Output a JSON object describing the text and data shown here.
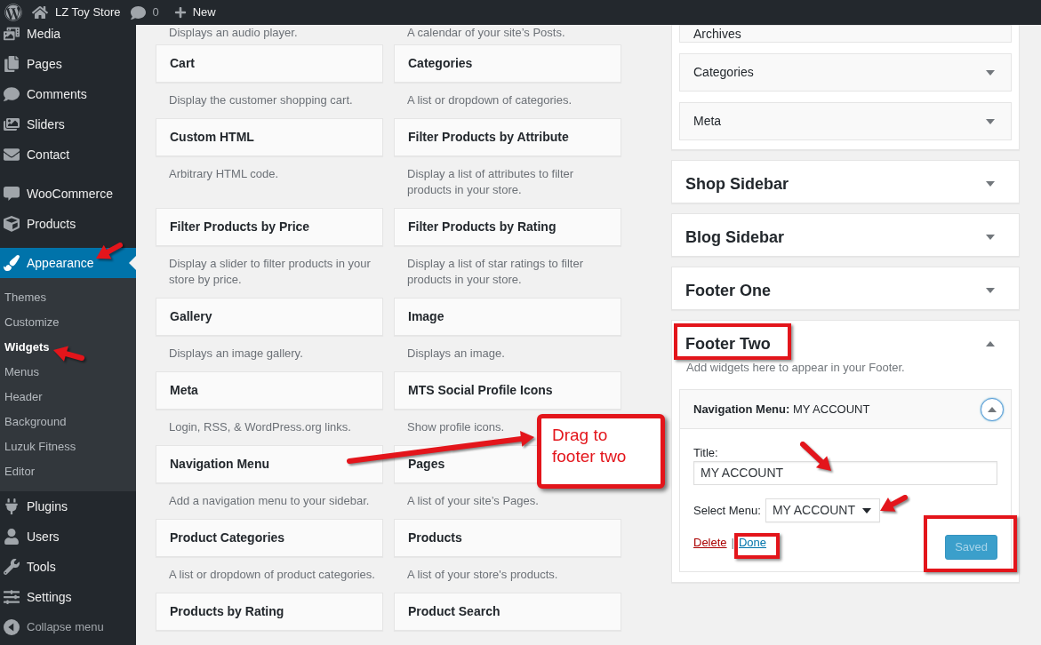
{
  "admin_bar": {
    "site_name": "LZ Toy Store",
    "comments_count": "0",
    "new_label": "New"
  },
  "sidebar": {
    "groups": [
      {
        "items": [
          {
            "label": "Media",
            "selected": false
          },
          {
            "label": "Pages",
            "selected": false
          },
          {
            "label": "Comments",
            "selected": false
          },
          {
            "label": "Sliders",
            "selected": false
          },
          {
            "label": "Contact",
            "selected": false
          }
        ]
      },
      {
        "items": [
          {
            "label": "WooCommerce",
            "selected": false
          },
          {
            "label": "Products",
            "selected": false
          }
        ]
      },
      {
        "items": [
          {
            "label": "Appearance",
            "selected": true,
            "expanded": true,
            "children": [
              {
                "label": "Themes",
                "selected": false
              },
              {
                "label": "Customize",
                "selected": false
              },
              {
                "label": "Widgets",
                "selected": true
              },
              {
                "label": "Menus",
                "selected": false
              },
              {
                "label": "Header",
                "selected": false
              },
              {
                "label": "Background",
                "selected": false
              },
              {
                "label": "Luzuk Fitness",
                "selected": false
              },
              {
                "label": "Editor",
                "selected": false
              }
            ]
          },
          {
            "label": "Plugins",
            "selected": false
          },
          {
            "label": "Users",
            "selected": false
          },
          {
            "label": "Tools",
            "selected": false
          },
          {
            "label": "Settings",
            "selected": false
          }
        ]
      }
    ],
    "collapse_label": "Collapse menu"
  },
  "available_widgets": [
    {
      "description": "Displays an audio player."
    },
    {
      "description": "A calendar of your site’s Posts."
    },
    {
      "title": "Cart",
      "description": "Display the customer shopping cart."
    },
    {
      "title": "Categories",
      "description": "A list or dropdown of categories."
    },
    {
      "title": "Custom HTML",
      "description": "Arbitrary HTML code."
    },
    {
      "title": "Filter Products by Attribute",
      "description": "Display a list of attributes to filter products in your store."
    },
    {
      "title": "Filter Products by Price",
      "description": "Display a slider to filter products in your store by price."
    },
    {
      "title": "Filter Products by Rating",
      "description": "Display a list of star ratings to filter products in your store."
    },
    {
      "title": "Gallery",
      "description": "Displays an image gallery."
    },
    {
      "title": "Image",
      "description": "Displays an image."
    },
    {
      "title": "Meta",
      "description": "Login, RSS, & WordPress.org links."
    },
    {
      "title": "MTS Social Profile Icons",
      "description": "Show profile icons."
    },
    {
      "title": "Navigation Menu",
      "description": "Add a navigation menu to your sidebar."
    },
    {
      "title": "Pages",
      "description": "A list of your site’s Pages."
    },
    {
      "title": "Product Categories",
      "description": "A list or dropdown of product categories."
    },
    {
      "title": "Products",
      "description": "A list of your store's products."
    },
    {
      "title": "Products by Rating"
    },
    {
      "title": "Product Search"
    }
  ],
  "widget_areas": [
    {
      "expanded": true,
      "highlighted": false,
      "widgets": [
        {
          "title": "Archives",
          "expanded": false
        },
        {
          "title": "Categories",
          "expanded": false
        },
        {
          "title": "Meta",
          "expanded": false
        }
      ]
    },
    {
      "title": "Shop Sidebar",
      "expanded": false,
      "highlighted": false
    },
    {
      "title": "Blog Sidebar",
      "expanded": false,
      "highlighted": false
    },
    {
      "title": "Footer One",
      "expanded": false,
      "highlighted": false
    },
    {
      "title": "Footer Two",
      "expanded": true,
      "highlighted": true,
      "description": "Add widgets here to appear in your Footer.",
      "widgets": [
        {
          "title": "**Navigation Menu:** MY ACCOUNT",
          "expanded": true,
          "form": {
            "fields": [
              {
                "kind": "text",
                "label": "Title:",
                "value": "MY ACCOUNT"
              },
              {
                "kind": "select",
                "label": "Select Menu:",
                "value": "MY ACCOUNT"
              }
            ],
            "actions": [
              {
                "kind": "danger_link",
                "label": "Delete",
                "highlighted": false
              },
              {
                "kind": "separator",
                "label": "|",
                "highlighted": false
              },
              {
                "kind": "link",
                "label": "Done",
                "highlighted": true
              },
              {
                "kind": "button",
                "label": "Saved",
                "disabled": true,
                "highlighted": true
              }
            ]
          }
        }
      ]
    }
  ],
  "annotations": {
    "callout": "Drag to footer two"
  }
}
